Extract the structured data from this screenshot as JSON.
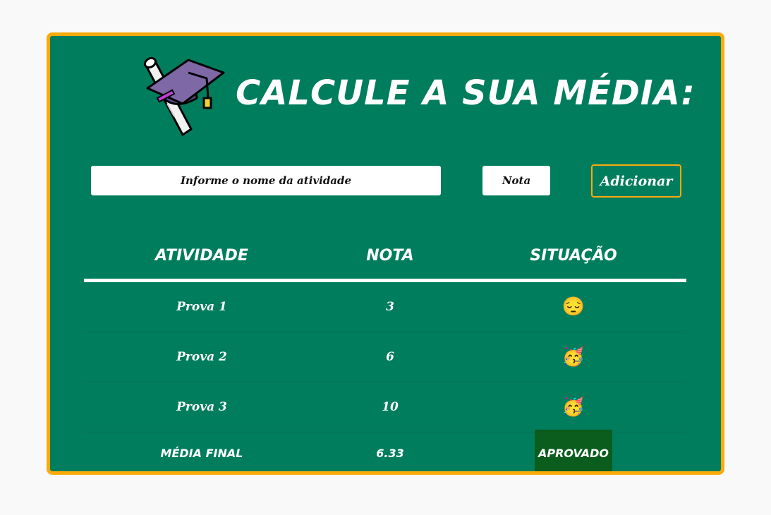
{
  "header": {
    "title": "Calcule a sua média:",
    "logo_icon": "graduation-cap-diploma-icon"
  },
  "form": {
    "activity_placeholder": "Informe o nome da atividade",
    "grade_placeholder": "Nota",
    "add_button_label": "Adicionar"
  },
  "table": {
    "columns": [
      "Atividade",
      "Nota",
      "Situação"
    ],
    "rows": [
      {
        "activity": "Prova 1",
        "grade": "3",
        "status_emoji": "😔",
        "status_icon": "sad-face-icon"
      },
      {
        "activity": "Prova 2",
        "grade": "6",
        "status_emoji": "🥳",
        "status_icon": "party-face-icon"
      },
      {
        "activity": "Prova 3",
        "grade": "10",
        "status_emoji": "🥳",
        "status_icon": "party-face-icon"
      }
    ],
    "footer": {
      "label": "Média final",
      "average": "6.33",
      "result": "Aprovado"
    }
  },
  "colors": {
    "background": "#007d5d",
    "border": "#fbaa0c",
    "approved_badge": "#0b5d1e",
    "page": "#f9f9f9"
  }
}
